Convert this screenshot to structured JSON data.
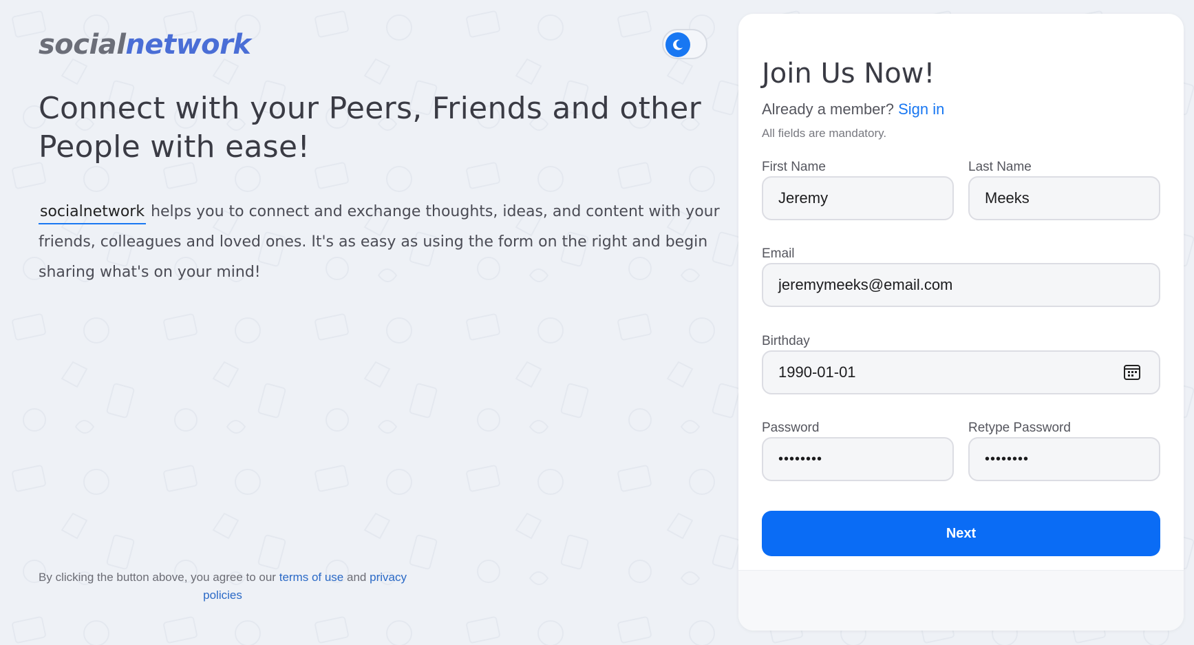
{
  "logo": {
    "part1": "social",
    "part2": "network"
  },
  "theme_toggle": {
    "icon": "moon-icon"
  },
  "hero": {
    "headline": "Connect with your Peers, Friends and other People with ease!",
    "brand": "socialnetwork",
    "description": "helps you to connect and exchange thoughts, ideas, and content with your friends, colleagues and loved ones. It's as easy as using the form on the right and begin sharing what's on your mind!"
  },
  "form": {
    "title": "Join Us Now!",
    "member_prompt": "Already a member?",
    "sign_in": "Sign in",
    "mandatory_note": "All fields are mandatory.",
    "first_name": {
      "label": "First Name",
      "value": "Jeremy"
    },
    "last_name": {
      "label": "Last Name",
      "value": "Meeks"
    },
    "email": {
      "label": "Email",
      "value": "jeremymeeks@email.com"
    },
    "birthday": {
      "label": "Birthday",
      "value": "1990-01-01"
    },
    "password": {
      "label": "Password",
      "value": "••••••••"
    },
    "retype_password": {
      "label": "Retype Password",
      "value": "••••••••"
    },
    "next_label": "Next",
    "terms_prefix": "By clicking the button above, you agree to our",
    "terms_link": "terms of use",
    "terms_and": "and",
    "privacy_link": "privacy policies"
  },
  "colors": {
    "accent": "#1877f2",
    "background": "#eef1f6",
    "logo_grey": "#6b6e78",
    "logo_blue": "#4a6ed6"
  }
}
